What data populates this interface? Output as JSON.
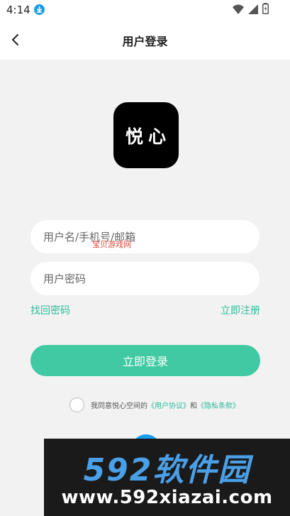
{
  "status_bar": {
    "time": "4:14"
  },
  "header": {
    "title": "用户登录"
  },
  "logo": {
    "text": "悦心"
  },
  "form": {
    "username_placeholder": "用户名/手机号/邮箱",
    "password_placeholder": "用户密码",
    "forgot_label": "找回密码",
    "register_label": "立即注册",
    "login_label": "立即登录"
  },
  "overlay_watermark": "宝贝游戏网",
  "agreement": {
    "prefix": "我同意悦心空间的",
    "user_agreement": "《用户协议》",
    "conjunction": "和",
    "privacy_policy": "《隐私条款》"
  },
  "ad_banner": {
    "brand": "592软件园",
    "url": "www.592xiazai.com"
  },
  "colors": {
    "accent": "#40c9a2",
    "link": "#2bbd9a",
    "page_bg": "#f2f2f2"
  }
}
